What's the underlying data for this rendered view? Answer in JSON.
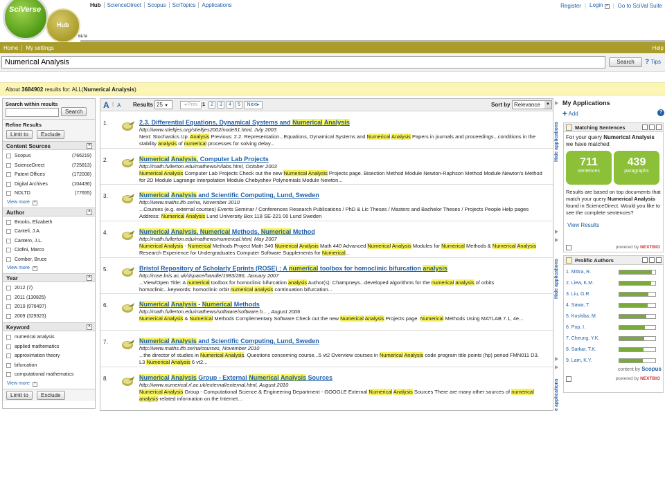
{
  "brand": {
    "logo": "SciVerse",
    "hub": "Hub",
    "beta": "BETA"
  },
  "topnav": [
    "Hub",
    "ScienceDirect",
    "Scopus",
    "SciTopics",
    "Applications"
  ],
  "toplinks": {
    "register": "Register",
    "login": "Login",
    "goto": "Go to SciVal Suite"
  },
  "menu": {
    "home": "Home",
    "settings": "My settings",
    "help": "Help"
  },
  "search": {
    "value": "Numerical Analysis",
    "button": "Search",
    "tips": "Tips"
  },
  "summary": {
    "about": "About",
    "count": "3684902",
    "mid": "results for: ALL(",
    "query": "Numerical Analysis",
    "end": ")"
  },
  "left": {
    "within_title": "Search within results",
    "search_btn": "Search",
    "refine_title": "Refine Results",
    "limit_btn": "Limit to",
    "exclude_btn": "Exclude",
    "view_more": "View more",
    "sources_title": "Content Sources",
    "sources": [
      {
        "label": "Scopus",
        "count": "(766219)"
      },
      {
        "label": "ScienceDirect",
        "count": "(725813)"
      },
      {
        "label": "Patent Offices",
        "count": "(172008)"
      },
      {
        "label": "Digital Archives",
        "count": "(104436)"
      },
      {
        "label": "NDLTD",
        "count": "(77655)"
      }
    ],
    "author_title": "Author",
    "authors": [
      "Brooks, Elizabeth",
      "Canteli, J.A.",
      "Cantero, J.L.",
      "Ciofini, Marco",
      "Comber, Bruce"
    ],
    "year_title": "Year",
    "years": [
      "2012 (7)",
      "2011 (130825)",
      "2010 (976497)",
      "2009 (329323)"
    ],
    "keyword_title": "Keyword",
    "keywords": [
      "numerical analysis",
      "applied mathematics",
      "approximation theory",
      "bifurcation",
      "computational mathematics"
    ]
  },
  "toolbar": {
    "font_a_big": "A",
    "font_a_small": "A",
    "results_label": "Results",
    "per_page": "25",
    "prev": "Prev",
    "pages": [
      "1",
      "2",
      "3",
      "4",
      "5"
    ],
    "next": "Next",
    "sort_label": "Sort by",
    "sort_value": "Relevance"
  },
  "results": [
    {
      "num": "1.",
      "title": "2.3. Differential Equations, Dynamical Systems and Numerical Analysis",
      "url": "http://www.stieltjes.org/stieltjes2002/node51.html, July 2003",
      "snippet": "Next: Stochastics Up: Analysis Previous: 2.2. Representation...Equations, Dynamical Systems and Numerical Analysis Papers in journals and proceedings...conditions in the stability analysis of numerical processes for solving delay..."
    },
    {
      "num": "2.",
      "title": "Numerical Analysis, Computer Lab Projects",
      "url": "http://math.fullerton.edu/mathews/n/labs.html, October 2003",
      "snippet": "Numerical Analysis Computer Lab Projects Check out the new Numerical Analysis Projects page. Bisection Method Module Newton-Raphson Method Module Newton's Method for 2D Module Lagrange Interpolation Module Chebyshev Polynomials Module Newton..."
    },
    {
      "num": "3.",
      "title": "Numerical Analysis and Scientific Computing, Lund, Sweden",
      "url": "http://www.maths.lth.se/na, November 2010",
      "snippet": "...Courses (e.g. external courses) Events Seminar / Conferences Research Publications / PhD & Lic Theses / Masters and Bachelor Theses / Projects People Help pages Address: Numerical Analysis Lund University Box 118 SE-221 00 Lund Sweden"
    },
    {
      "num": "4.",
      "title": "Numerical Analysis, Numerical Methods, Numerical Method",
      "url": "http://math.fullerton.edu/mathews/numerical.html, May 2007",
      "snippet": "Numerical Analysis - Numerical Methods Project Math 340 Numerical Analysis Math 440 Advanced Numerical Analysis Modules for Numerical Methods & Numerical Analysis Research Experience for Undergraduates Computer Software Supplements for Numerical..."
    },
    {
      "num": "5.",
      "title": "Bristol Repository of Scholarly Eprints (ROSE) : A numerical toolbox for homoclinic bifurcation analysis",
      "url": "http://rose.bris.ac.uk/dspace/handle/1983/286, January 2007",
      "snippet": "...View/Open Title: A numerical toolbox for homoclinic bifurcation analysis Author(s): Champneys...developed algorithms for the numerical analysis of orbits homoclinic...keywords: homoclinic orbit numerical analysis continuation bifurcation..."
    },
    {
      "num": "6.",
      "title": "Numerical Analysis - Numerical Methods",
      "url": "http://math.fullerton.edu/mathews/software/software.h... , August 2006",
      "snippet": "Numerical Analysis & Numerical Methods Complementary Software Check out the new Numerical Analysis Projects page. Numerical Methods Using MATLAB 7.1, 4e..."
    },
    {
      "num": "7.",
      "title": "Numerical Analysis and Scientific Computing, Lund, Sweden",
      "url": "http://www.maths.lth.se/na/courses, November 2010",
      "snippet": "...the director of studies in Numerical Analysis. Questions concerning course...5 vt2 Overview courses in Numerical Analysis code program title points (hp) period FMN011 D3, L3 Numerical Analysis 6 vt2..."
    },
    {
      "num": "8.",
      "title": "Numerical Analysis Group - External Numerical Analysis Sources",
      "url": "http://www.numerical.rl.ac.uk/external/external.html, August 2010",
      "snippet": "Numerical Analysis Group - Computational Science & Engineering Department - GOOGLE External Numerical Analysis Sources There are many other sources of numerical analysis-related information on the Internet..."
    }
  ],
  "hide_apps": [
    "Hide applications",
    "Hide applications",
    "e applications"
  ],
  "right": {
    "title": "My Applications",
    "add": "Add",
    "ms_title": "Matching Sentences",
    "ms_intro_1": "For your query",
    "ms_intro_q": "Numerical Analysis",
    "ms_intro_2": "we have matched",
    "sentences_n": "711",
    "sentences_l": "sentences",
    "paragraphs_n": "439",
    "paragraphs_l": "paragraphs",
    "ms_note_1": "Results are based on top documents that match your query",
    "ms_note_q": "Numerical Analysis",
    "ms_note_2": "found in ScienceDirect. Would you like to see the complete sentences?",
    "view_results": "View Results",
    "powered_by": "powered by",
    "nextbio": "NEXTBIO",
    "pa_title": "Prolific Authors",
    "authors": [
      {
        "name": "1. Mittra, R.",
        "level": 0.9
      },
      {
        "name": "2. Liew, K.M.",
        "level": 0.88
      },
      {
        "name": "3. Liu, G.R.",
        "level": 0.8
      },
      {
        "name": "4. Sawa, T.",
        "level": 0.78
      },
      {
        "name": "5. Koshiba, M.",
        "level": 0.75
      },
      {
        "name": "6. Pop, I.",
        "level": 0.72
      },
      {
        "name": "7. Cheung, Y.K.",
        "level": 0.7
      },
      {
        "name": "8. Sarkar, T.K.",
        "level": 0.68
      },
      {
        "name": "9. Lam, K.Y.",
        "level": 0.66
      }
    ],
    "content_by": "content by",
    "scopus": "Scopus"
  }
}
